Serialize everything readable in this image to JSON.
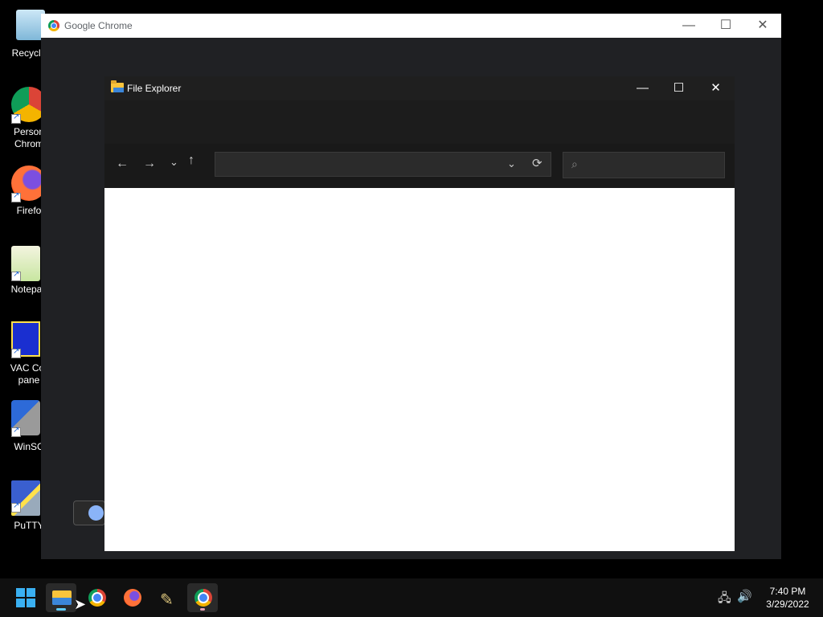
{
  "desktop": {
    "icons": [
      {
        "label": "Recycle",
        "icon": "recycle-bin-icon"
      },
      {
        "label": "Person\nChrom",
        "icon": "chrome-icon"
      },
      {
        "label": "Firefo",
        "icon": "firefox-icon"
      },
      {
        "label": "Notepac",
        "icon": "notepad-plus-plus-icon"
      },
      {
        "label": "VAC Cor\npane",
        "icon": "vac-control-panel-icon"
      },
      {
        "label": "WinSC",
        "icon": "winscp-icon"
      },
      {
        "label": "PuTTY",
        "icon": "putty-icon"
      }
    ]
  },
  "chrome_window": {
    "title": "Google Chrome",
    "controls": {
      "minimize": "—",
      "maximize": "☐",
      "close": "✕"
    }
  },
  "explorer_window": {
    "title": "File Explorer",
    "controls": {
      "minimize": "—",
      "maximize": "☐",
      "close": "✕"
    },
    "nav": {
      "back": "←",
      "forward": "→",
      "recent": "⌄",
      "up": "↑"
    },
    "address_value": "",
    "address_dropdown": "⌄",
    "refresh": "⟳",
    "search_glyph": "⌕",
    "search_value": ""
  },
  "taskbar": {
    "items": [
      {
        "name": "start",
        "icon": "windows-start-icon"
      },
      {
        "name": "file-explorer",
        "icon": "folder-icon",
        "active": true
      },
      {
        "name": "chrome",
        "icon": "chrome-icon"
      },
      {
        "name": "firefox",
        "icon": "firefox-icon"
      },
      {
        "name": "tool",
        "icon": "tool-icon"
      },
      {
        "name": "chrome-profile",
        "icon": "chrome-icon",
        "active": true
      }
    ],
    "tray": {
      "network": "🖧",
      "volume": "🔊"
    },
    "clock": {
      "time": "7:40 PM",
      "date": "3/29/2022"
    }
  },
  "colors": {
    "accent": "#60cdff",
    "explorer_bg": "#1f1f1f",
    "chrome_bg": "#202124"
  }
}
